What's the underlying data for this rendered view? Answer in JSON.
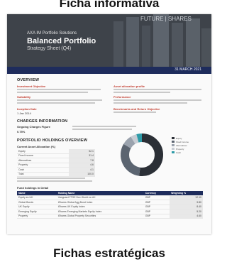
{
  "banner_top": "Ficha informativa",
  "banner_bottom": "Fichas estratégicas",
  "doc": {
    "brand": "AXA IM Portfolio Solutions",
    "fund_name": "Balanced Portfolio",
    "subtitle": "Strategy Sheet (Q4)",
    "watermark": "FUTURE | SHARES",
    "date": "31 MARCH 2021",
    "overview": {
      "title": "OVERVIEW",
      "left_labels": [
        "Investment Objective",
        "Suitability",
        "Inception Date"
      ],
      "inception_value": "1 Jan 2014",
      "right_labels": [
        "Asset allocation profile",
        "Performance",
        "Benchmarks and Return Objective"
      ]
    },
    "charges": {
      "title": "CHARGES INFORMATION",
      "label": "Ongoing Charges Figure",
      "value": "0.75%"
    },
    "holdings": {
      "title": "PORTFOLIO HOLDINGS OVERVIEW",
      "table_title": "Current Asset Allocation (%)",
      "rows": [
        {
          "name": "Equity",
          "value": "52.1"
        },
        {
          "name": "Fixed Income",
          "value": "31.4"
        },
        {
          "name": "Alternatives",
          "value": "7.8"
        },
        {
          "name": "Property",
          "value": "4.6"
        },
        {
          "name": "Cash",
          "value": "4.1"
        },
        {
          "name": "Total",
          "value": "100.0"
        }
      ],
      "top_title": "Fund holdings in Detail",
      "top_head": [
        "Name",
        "Holding Name",
        "Currency",
        "Weighting %"
      ],
      "top_rows": [
        [
          "Equity ex-UK",
          "Vanguard FTSE Dev World ex-UK",
          "GBP",
          "12.10"
        ],
        [
          "Global Bonds",
          "iShares Global Agg Bond Index",
          "GBP",
          "9.80"
        ],
        [
          "UK Equity",
          "iShares UK Equity Index",
          "GBP",
          "8.40"
        ],
        [
          "Emerging Equity",
          "iShares Emerging Markets Equity Index",
          "GBP",
          "5.20"
        ],
        [
          "Property",
          "iShares Global Property Securities",
          "GBP",
          "4.60"
        ]
      ],
      "donut_values": [
        52.1,
        31.4,
        7.8,
        4.6,
        4.1
      ],
      "donut_colors": [
        "#2b2f36",
        "#5b6470",
        "#9aa2ad",
        "#c7ccd3",
        "#2e9ba8"
      ],
      "legend": [
        "Equity",
        "Fixed Income",
        "Alternatives",
        "Property",
        "Cash"
      ]
    }
  }
}
